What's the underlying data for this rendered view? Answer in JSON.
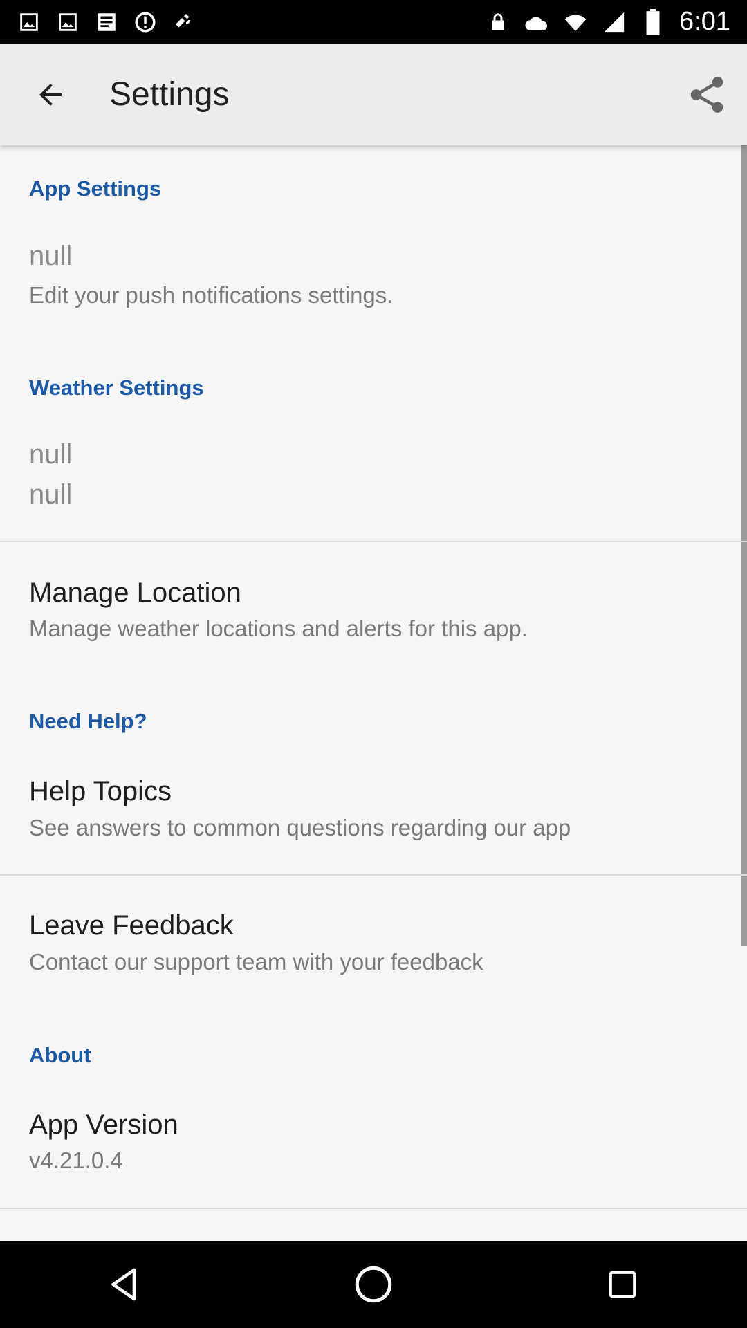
{
  "status_bar": {
    "time": "6:01",
    "icons_left": [
      "photo-icon",
      "photo-icon",
      "image-icon",
      "alert-circle-icon",
      "satellite-icon"
    ],
    "icons_right": [
      "lock-icon",
      "cloud-icon",
      "wifi-icon",
      "signal-icon",
      "battery-icon"
    ]
  },
  "app_bar": {
    "title": "Settings",
    "back_icon": "arrow-back-icon",
    "share_icon": "share-icon"
  },
  "sections": {
    "app_settings": {
      "header": "App Settings",
      "item_title": "null",
      "item_summary": "Edit your push notifications settings."
    },
    "weather_settings": {
      "header": "Weather Settings",
      "item1": "null",
      "item2": "null"
    },
    "manage_location": {
      "title": "Manage Location",
      "summary": "Manage weather locations and alerts for this app."
    },
    "need_help": {
      "header": "Need Help?",
      "help_title": "Help Topics",
      "help_summary": "See answers to common questions regarding our app",
      "feedback_title": "Leave Feedback",
      "feedback_summary": "Contact our support team with your feedback"
    },
    "about": {
      "header": "About",
      "version_title": "App Version",
      "version_value": "v4.21.0.4"
    }
  },
  "colors": {
    "section_header": "#1c5aa6",
    "app_bar_bg": "#ececec",
    "background": "#f6f6f6"
  },
  "nav_bar": {
    "icons": [
      "back-triangle-icon",
      "home-circle-icon",
      "recents-square-icon"
    ]
  }
}
